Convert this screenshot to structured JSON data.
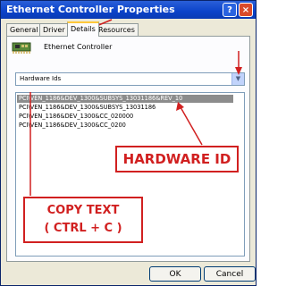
{
  "window": {
    "title": "Ethernet Controller Properties",
    "help_glyph": "?",
    "close_glyph": "×"
  },
  "tabs": [
    {
      "label": "General"
    },
    {
      "label": "Driver"
    },
    {
      "label": "Details",
      "active": true
    },
    {
      "label": "Resources"
    }
  ],
  "device": {
    "name": "Ethernet Controller",
    "icon": "network-adapter-icon"
  },
  "property_select": {
    "value": "Hardware Ids",
    "arrow": "▼"
  },
  "hardware_ids": [
    "PCI\\VEN_1186&DEV_1300&SUBSYS_13031186&REV_10",
    "PCI\\VEN_1186&DEV_1300&SUBSYS_13031186",
    "PCI\\VEN_1186&DEV_1300&CC_020000",
    "PCI\\VEN_1186&DEV_1300&CC_0200"
  ],
  "annotations": {
    "hardware_id": "HARDWARE ID",
    "copy_text_line1": "COPY TEXT",
    "copy_text_line2": "( CTRL + C )",
    "color": "#d12020"
  },
  "buttons": {
    "ok": "OK",
    "cancel": "Cancel"
  },
  "colors": {
    "titlebar": "#0b43c9",
    "dialog_bg": "#ece9d8",
    "selection": "#8c8c8c",
    "active_tab_accent": "#ffc83c"
  }
}
